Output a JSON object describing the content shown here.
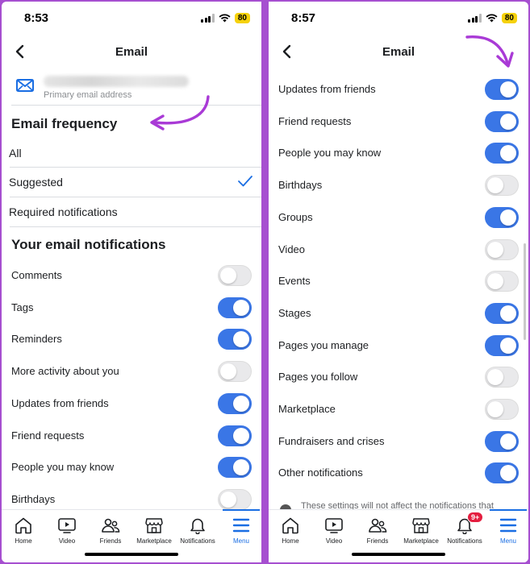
{
  "left": {
    "status": {
      "time": "8:53",
      "battery": "80"
    },
    "header": {
      "title": "Email"
    },
    "email": {
      "sublabel": "Primary email address"
    },
    "frequency": {
      "title": "Email frequency",
      "options": [
        {
          "label": "All",
          "selected": false
        },
        {
          "label": "Suggested",
          "selected": true
        },
        {
          "label": "Required notifications",
          "selected": false
        }
      ]
    },
    "notifications": {
      "title": "Your email notifications",
      "items": [
        {
          "label": "Comments",
          "on": false
        },
        {
          "label": "Tags",
          "on": true
        },
        {
          "label": "Reminders",
          "on": true
        },
        {
          "label": "More activity about you",
          "on": false
        },
        {
          "label": "Updates from friends",
          "on": true
        },
        {
          "label": "Friend requests",
          "on": true
        },
        {
          "label": "People you may know",
          "on": true
        },
        {
          "label": "Birthdays",
          "on": false
        }
      ]
    },
    "tabs": [
      {
        "label": "Home",
        "icon": "home-icon"
      },
      {
        "label": "Video",
        "icon": "video-icon"
      },
      {
        "label": "Friends",
        "icon": "friends-icon"
      },
      {
        "label": "Marketplace",
        "icon": "marketplace-icon"
      },
      {
        "label": "Notifications",
        "icon": "bell-icon"
      },
      {
        "label": "Menu",
        "icon": "menu-icon",
        "active": true
      }
    ]
  },
  "right": {
    "status": {
      "time": "8:57",
      "battery": "80"
    },
    "header": {
      "title": "Email"
    },
    "notifications": {
      "items": [
        {
          "label": "Updates from friends",
          "on": true
        },
        {
          "label": "Friend requests",
          "on": true
        },
        {
          "label": "People you may know",
          "on": true
        },
        {
          "label": "Birthdays",
          "on": false
        },
        {
          "label": "Groups",
          "on": true
        },
        {
          "label": "Video",
          "on": false
        },
        {
          "label": "Events",
          "on": false
        },
        {
          "label": "Stages",
          "on": true
        },
        {
          "label": "Pages you manage",
          "on": true
        },
        {
          "label": "Pages you follow",
          "on": false
        },
        {
          "label": "Marketplace",
          "on": false
        },
        {
          "label": "Fundraisers and crises",
          "on": true
        },
        {
          "label": "Other notifications",
          "on": true
        }
      ]
    },
    "footer_note": "These settings will not affect the notifications that",
    "tabs": [
      {
        "label": "Home",
        "icon": "home-icon"
      },
      {
        "label": "Video",
        "icon": "video-icon"
      },
      {
        "label": "Friends",
        "icon": "friends-icon"
      },
      {
        "label": "Marketplace",
        "icon": "marketplace-icon"
      },
      {
        "label": "Notifications",
        "icon": "bell-icon",
        "badge": "9+"
      },
      {
        "label": "Menu",
        "icon": "menu-icon",
        "active": true
      }
    ]
  },
  "colors": {
    "frame": "#a64fd0",
    "toggle_on": "#3a76e6",
    "toggle_off": "#e9e9eb",
    "accent": "#1a6ee3",
    "annotation_arrow": "#a93ad6",
    "badge": "#e41e3f"
  }
}
